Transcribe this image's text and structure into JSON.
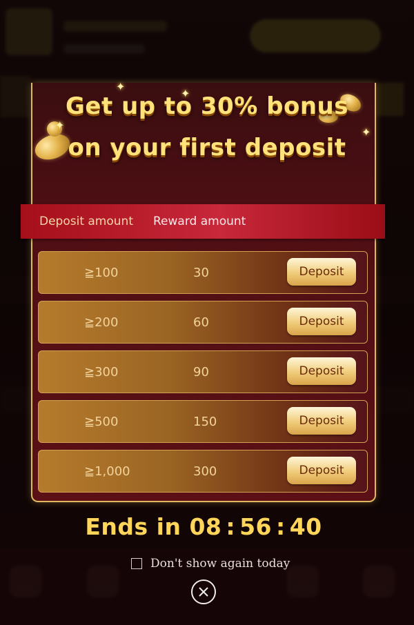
{
  "promo": {
    "headline_line1": "Get up to 30% bonus",
    "headline_line2": "on your first deposit"
  },
  "table": {
    "col_deposit": "Deposit amount",
    "col_reward": "Reward amount",
    "rows": [
      {
        "deposit": "≧100",
        "reward": "30",
        "button": "Deposit"
      },
      {
        "deposit": "≧200",
        "reward": "60",
        "button": "Deposit"
      },
      {
        "deposit": "≧300",
        "reward": "90",
        "button": "Deposit"
      },
      {
        "deposit": "≧500",
        "reward": "150",
        "button": "Deposit"
      },
      {
        "deposit": "≧1,000",
        "reward": "300",
        "button": "Deposit"
      }
    ]
  },
  "countdown": {
    "prefix": "Ends in",
    "hours": "08",
    "minutes": "56",
    "seconds": "40"
  },
  "footer": {
    "dont_show_label": "Don't show again today",
    "dont_show_checked": false
  },
  "icons": {
    "close": "close-circle-icon",
    "checkbox": "checkbox-icon"
  },
  "colors": {
    "accent_gold": "#ffd65a",
    "header_red": "#c8283a",
    "button_gold": "#f0cc7a"
  }
}
